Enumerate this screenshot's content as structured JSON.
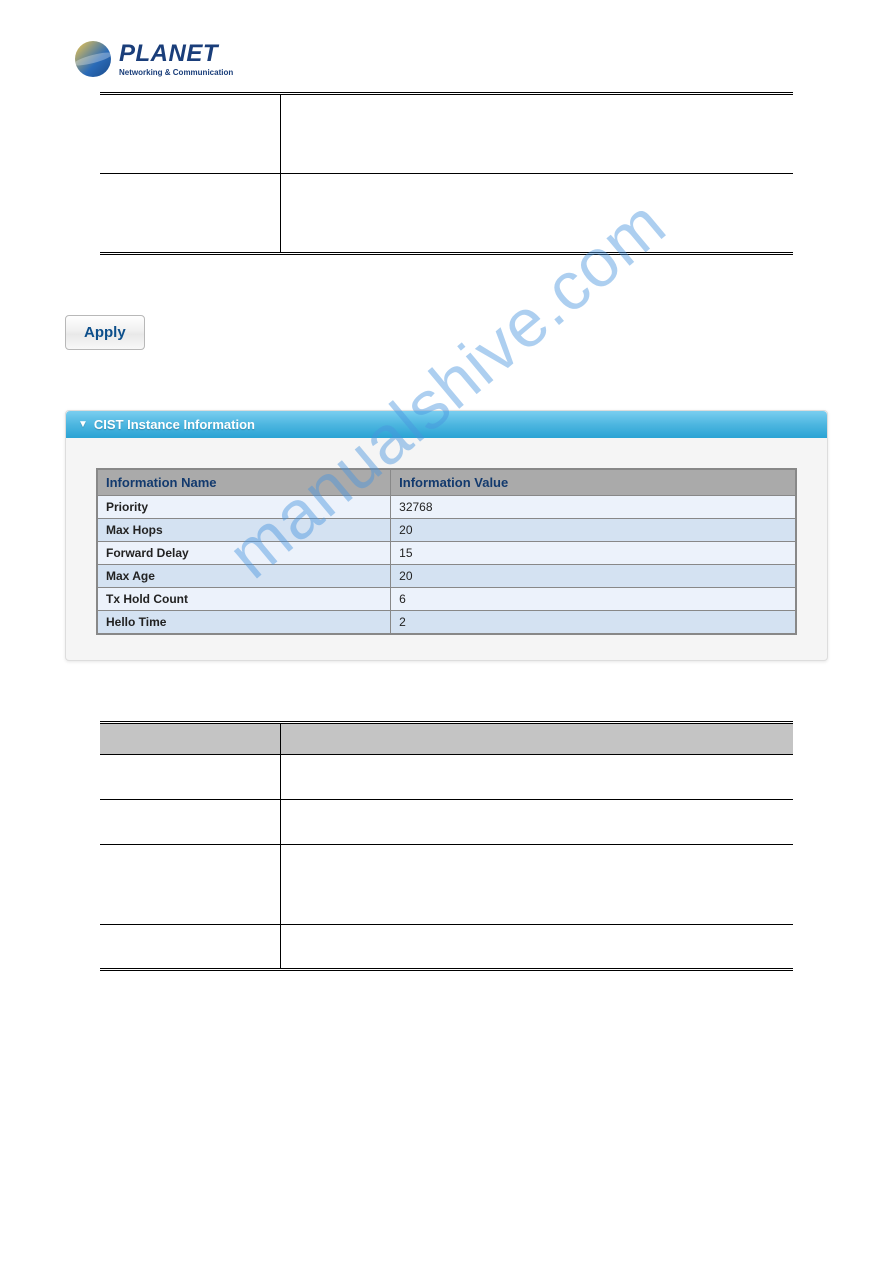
{
  "logo": {
    "name": "PLANET",
    "tagline": "Networking & Communication"
  },
  "apply_button": "Apply",
  "panel": {
    "title": "CIST Instance Information",
    "headers": {
      "name": "Information Name",
      "value": "Information Value"
    },
    "rows": [
      {
        "name": "Priority",
        "value": "32768"
      },
      {
        "name": "Max Hops",
        "value": "20"
      },
      {
        "name": "Forward Delay",
        "value": "15"
      },
      {
        "name": "Max Age",
        "value": "20"
      },
      {
        "name": "Tx Hold Count",
        "value": "6"
      },
      {
        "name": "Hello Time",
        "value": "2"
      }
    ]
  },
  "watermark": "manualshive.com"
}
